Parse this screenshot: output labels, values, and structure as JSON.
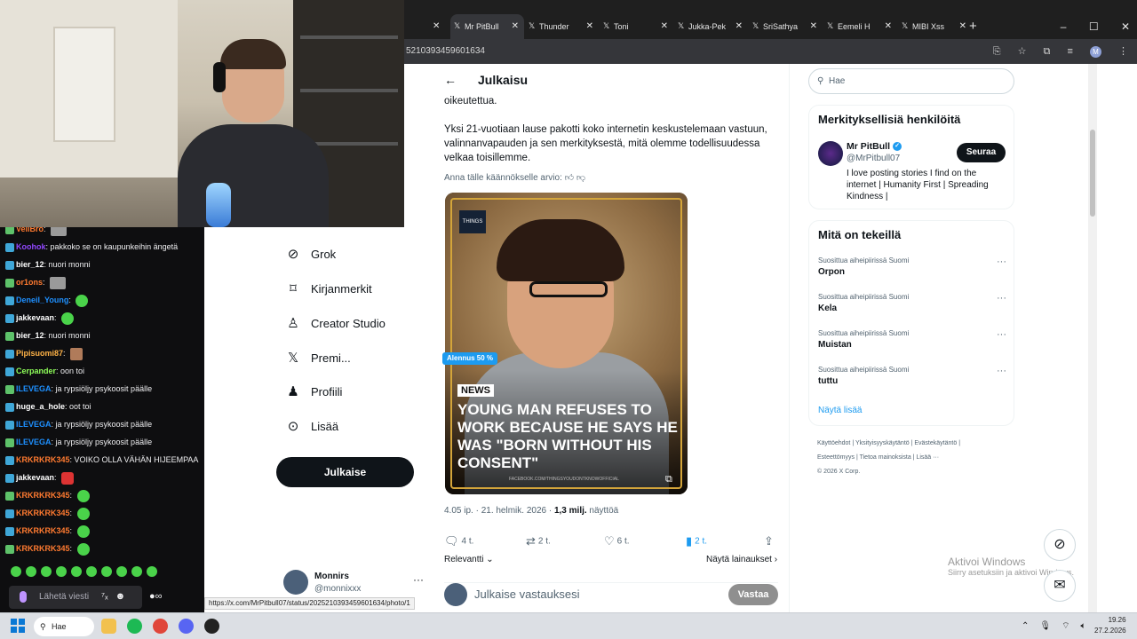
{
  "browser": {
    "tabs": [
      {
        "label": "Mr PitBull",
        "active": true
      },
      {
        "label": "Thunder",
        "active": false
      },
      {
        "label": "Toni",
        "active": false
      },
      {
        "label": "Jukka-Pek",
        "active": false
      },
      {
        "label": "SriSathya",
        "active": false
      },
      {
        "label": "Eemeli H",
        "active": false
      },
      {
        "label": "MIBI Xss",
        "active": false
      }
    ],
    "new_tab": "+",
    "url": "5210393459601634",
    "window_controls": {
      "minimize": "–",
      "maximize": "☐",
      "close": "✕"
    }
  },
  "post": {
    "back": "←",
    "title": "Julkaisu",
    "text_lines": [
      "oikeutettua.",
      "Yksi 21-vuotiaan lause pakotti koko internetin keskustelemaan vastuun, valinnanvapauden ja sen merkityksestä, mitä olemme todellisuudessa velkaa toisillemme."
    ],
    "translation_rating": "Anna tälle käännökselle arvio:",
    "media": {
      "tag": "NEWS",
      "headline": "YOUNG MAN REFUSES TO WORK BECAUSE HE SAYS HE WAS \"BORN WITHOUT HIS CONSENT\"",
      "credit": "FACEBOOK.COM/THINGSYOUDONTKNOWOFFICIAL",
      "logo": "THINGS"
    },
    "meta": "4.05 ip. · 21. helmik. 2026 · ",
    "views": "1,3 milj.",
    "views_label": " näyttöä",
    "actions": {
      "replies": "4 t.",
      "reposts": "2 t.",
      "likes": "6 t.",
      "bookmarks": "2 t."
    },
    "relevant": "Relevantti",
    "quotes": "Näytä lainaukset",
    "reply_prompt": "Julkaise vastauksesi",
    "reply_button": "Vastaa"
  },
  "sidebar": {
    "search_placeholder": "Hae",
    "who_to_follow_title": "Merkityksellisiä henkilöitä",
    "profile": {
      "name": "Mr PitBull",
      "handle": "@MrPitbull07",
      "bio": "I love posting stories I find on the internet | Humanity First | Spreading Kindness |",
      "follow": "Seuraa"
    },
    "trends_title": "Mitä on tekeillä",
    "trends": [
      {
        "context": "Suosittua aiheipiirissä Suomi",
        "name": "Orpon"
      },
      {
        "context": "Suosittua aiheipiirissä Suomi",
        "name": "Kela"
      },
      {
        "context": "Suosittua aiheipiirissä Suomi",
        "name": "Muistan"
      },
      {
        "context": "Suosittua aiheipiirissä Suomi",
        "name": "tuttu"
      }
    ],
    "show_more": "Näytä lisää",
    "footer": [
      "Käyttöehdot",
      "Yksityisyyskäytäntö",
      "Evästekäytäntö",
      "Esteettömyys",
      "Tietoa mainoksista",
      "Lisää ···",
      "© 2026 X Corp."
    ]
  },
  "windows_activation": {
    "title": "Aktivoi Windows",
    "subtitle": "Siirry asetuksiin ja aktivoi Windows."
  },
  "nav": {
    "items": [
      {
        "label": "Grok",
        "icon": "grok-icon"
      },
      {
        "label": "Kirjanmerkit",
        "icon": "bookmark-icon"
      },
      {
        "label": "Creator Studio",
        "icon": "creator-icon"
      },
      {
        "label": "Premi...",
        "icon": "x-icon"
      },
      {
        "label": "Profiili",
        "icon": "profile-icon"
      },
      {
        "label": "Lisää",
        "icon": "more-icon"
      }
    ],
    "premium_badge": "Alennus 50 %",
    "post_button": "Julkaise",
    "account": {
      "name": "Monnirs",
      "handle": "@monnixxx"
    }
  },
  "status_url": "https://x.com/MrPitbull07/status/2025210393459601634/photo/1",
  "chat": {
    "messages": [
      {
        "user": "VeliBro",
        "color": "#ff7a30",
        "text": ""
      },
      {
        "user": "Koohok",
        "color": "#9147ff",
        "text": "pakkoko se on kaupunkeihin ängetä"
      },
      {
        "user": "bier_12",
        "color": "#ffffff",
        "text": "nuori monni"
      },
      {
        "user": "or1ons",
        "color": "#ff7a30",
        "text": ""
      },
      {
        "user": "Deneil_Young",
        "color": "#1e90ff",
        "text": ""
      },
      {
        "user": "jakkevaan",
        "color": "#ffffff",
        "text": ""
      },
      {
        "user": "bier_12",
        "color": "#ffffff",
        "text": "nuori monni"
      },
      {
        "user": "Pipisuomi87",
        "color": "#ffb347",
        "text": ""
      },
      {
        "user": "Cerpander",
        "color": "#8fff5a",
        "text": "oon toi"
      },
      {
        "user": "ILEVEGA",
        "color": "#1e90ff",
        "text": "ja rypsiöljy psykoosit päälle"
      },
      {
        "user": "huge_a_hole",
        "color": "#ffffff",
        "text": "oot toi"
      },
      {
        "user": "ILEVEGA",
        "color": "#1e90ff",
        "text": "ja rypsiöljy psykoosit päälle"
      },
      {
        "user": "ILEVEGA",
        "color": "#1e90ff",
        "text": "ja rypsiöljy psykoosit päälle"
      },
      {
        "user": "KRKRKRK345",
        "color": "#ff7a30",
        "text": "VOIKO OLLA VÄHÄN HIJEEMPAA"
      },
      {
        "user": "jakkevaan",
        "color": "#ffffff",
        "text": ""
      },
      {
        "user": "KRKRKRK345",
        "color": "#ff7a30",
        "text": ""
      },
      {
        "user": "KRKRKRK345",
        "color": "#ff7a30",
        "text": ""
      },
      {
        "user": "KRKRKRK345",
        "color": "#ff7a30",
        "text": ""
      },
      {
        "user": "KRKRKRK345",
        "color": "#ff7a30",
        "text": ""
      }
    ],
    "input_placeholder": "Lähetä viesti"
  },
  "taskbar": {
    "search": "Hae",
    "time": "19.26",
    "date": "27.2.2026"
  }
}
